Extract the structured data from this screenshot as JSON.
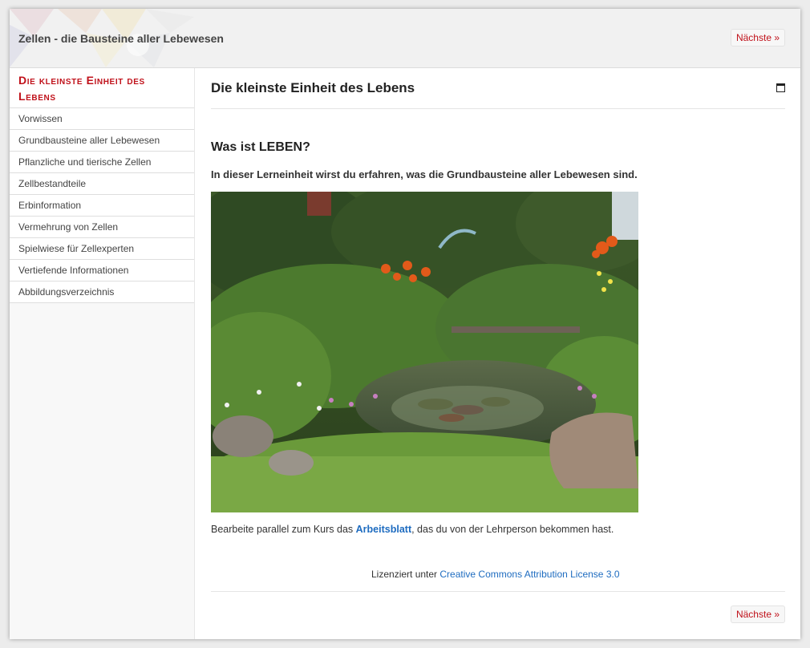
{
  "header": {
    "title": "Zellen - die Bausteine aller Lebewesen",
    "next_label": "Nächste »"
  },
  "sidebar": {
    "heading": "Die kleinste Einheit des Lebens",
    "items": [
      {
        "label": "Vorwissen"
      },
      {
        "label": "Grundbausteine aller Lebewesen"
      },
      {
        "label": "Pflanzliche und tierische Zellen"
      },
      {
        "label": "Zellbestandteile"
      },
      {
        "label": "Erbinformation"
      },
      {
        "label": "Vermehrung von Zellen"
      },
      {
        "label": "Spielwiese für Zellexperten"
      },
      {
        "label": "Vertiefende Informationen"
      },
      {
        "label": "Abbildungsverzeichnis"
      }
    ]
  },
  "main": {
    "title": "Die kleinste Einheit des Lebens",
    "section_heading": "Was ist LEBEN?",
    "intro": "In dieser Lerneinheit wirst du erfahren, was die Grundbausteine aller Lebewesen sind.",
    "instruction_before": "Bearbeite parallel zum Kurs das ",
    "instruction_link": "Arbeitsblatt",
    "instruction_after": ", das du von der Lehrperson bekommen hast.",
    "license_prefix": "Lizenziert unter ",
    "license_link": "Creative Commons Attribution License 3.0",
    "next_label": "Nächste »"
  },
  "colors": {
    "accent": "#c0111a",
    "link": "#1e6cc0"
  },
  "icons": [
    "maximize-icon",
    "garden-pond-photo"
  ]
}
